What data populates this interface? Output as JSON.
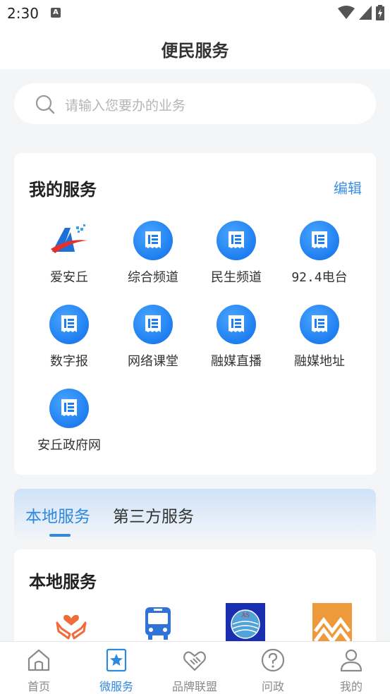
{
  "status_bar": {
    "time": "2:30",
    "notification_badge": "A"
  },
  "header": {
    "title": "便民服务"
  },
  "search": {
    "placeholder": "请输入您要办的业务"
  },
  "my_services": {
    "title": "我的服务",
    "edit_label": "编辑",
    "items": [
      {
        "label": "爱安丘",
        "icon": "aianqiu-logo"
      },
      {
        "label": "综合频道",
        "icon": "document-icon"
      },
      {
        "label": "民生频道",
        "icon": "document-icon"
      },
      {
        "label": "92.4电台",
        "icon": "document-icon"
      },
      {
        "label": "数字报",
        "icon": "document-icon"
      },
      {
        "label": "网络课堂",
        "icon": "document-icon"
      },
      {
        "label": "融媒直播",
        "icon": "document-icon"
      },
      {
        "label": "融媒地址",
        "icon": "document-icon"
      },
      {
        "label": "安丘政府网",
        "icon": "document-icon"
      }
    ]
  },
  "service_tabs": [
    {
      "label": "本地服务",
      "active": true
    },
    {
      "label": "第三方服务",
      "active": false
    }
  ],
  "local_services": {
    "title": "本地服务",
    "icons": [
      "care-hands-icon",
      "bus-icon",
      "as-logo",
      "mountain-logo"
    ]
  },
  "bottom_nav": [
    {
      "label": "首页",
      "icon": "home-icon",
      "active": false
    },
    {
      "label": "微服务",
      "icon": "star-bookmark-icon",
      "active": true
    },
    {
      "label": "品牌联盟",
      "icon": "handshake-icon",
      "active": false
    },
    {
      "label": "问政",
      "icon": "question-icon",
      "active": false
    },
    {
      "label": "我的",
      "icon": "user-icon",
      "active": false
    }
  ],
  "colors": {
    "accent": "#2f88e0",
    "icon_blue": "#1e7ef0",
    "inactive": "#8a8a8a"
  }
}
